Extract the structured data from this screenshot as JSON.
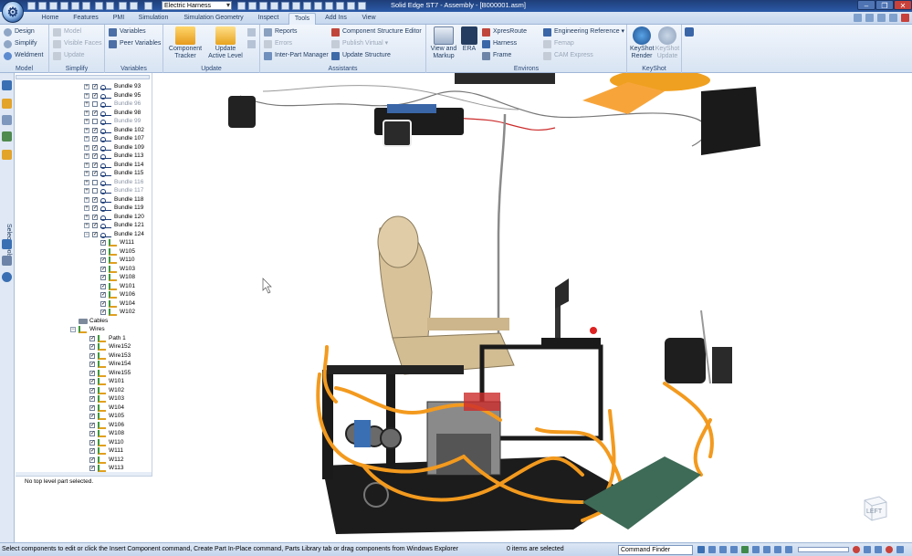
{
  "titlebar": {
    "environment": "Electric Harness",
    "window_title": "Solid Edge ST7 - Assembly - [B000001.asm]",
    "minimize": "–",
    "restore": "❐",
    "close": "✕"
  },
  "tabs": [
    {
      "label": "Home"
    },
    {
      "label": "Features"
    },
    {
      "label": "PMI"
    },
    {
      "label": "Simulation"
    },
    {
      "label": "Simulation Geometry"
    },
    {
      "label": "Inspect"
    },
    {
      "label": "Tools",
      "active": true
    },
    {
      "label": "Add Ins"
    },
    {
      "label": "View"
    }
  ],
  "ribbon": {
    "model": {
      "label": "Model",
      "items": [
        "Design",
        "Simplify",
        "Weldment"
      ]
    },
    "simplify": {
      "label": "Simplify",
      "items": [
        "Model",
        "Visible Faces",
        "Update"
      ]
    },
    "variables": {
      "label": "Variables",
      "items": [
        "Variables",
        "Peer Variables"
      ]
    },
    "update": {
      "label": "Update",
      "component_tracker": "Component Tracker",
      "update_active_level": "Update Active Level"
    },
    "assistants": {
      "label": "Assistants",
      "reports": "Reports",
      "errors": "Errors",
      "inter_part_manager": "Inter-Part Manager",
      "component_structure_editor": "Component Structure Editor",
      "publish_virtual": "Publish Virtual",
      "update_structure": "Update Structure"
    },
    "environs": {
      "label": "Environs",
      "view_markup": "View and Markup",
      "era": "ERA",
      "xpresroute": "XpresRoute",
      "harness": "Harness",
      "frame": "Frame",
      "engineering_reference": "Engineering Reference",
      "femap": "Femap",
      "cam_express": "CAM Express"
    },
    "keyshot": {
      "label": "KeyShot",
      "render": "KeyShot Render",
      "update": "KeyShot Update"
    }
  },
  "left_strip": {
    "select_tools": "Select Tools"
  },
  "pathfinder": {
    "bundles": [
      {
        "label": "Bundle 93",
        "checked": true
      },
      {
        "label": "Bundle 95",
        "checked": true
      },
      {
        "label": "Bundle 96",
        "checked": false
      },
      {
        "label": "Bundle 98",
        "checked": true
      },
      {
        "label": "Bundle 99",
        "checked": false
      },
      {
        "label": "Bundle 102",
        "checked": true
      },
      {
        "label": "Bundle 107",
        "checked": true
      },
      {
        "label": "Bundle 109",
        "checked": true
      },
      {
        "label": "Bundle 113",
        "checked": true
      },
      {
        "label": "Bundle 114",
        "checked": true
      },
      {
        "label": "Bundle 115",
        "checked": true
      },
      {
        "label": "Bundle 116",
        "checked": false
      },
      {
        "label": "Bundle 117",
        "checked": false
      },
      {
        "label": "Bundle 118",
        "checked": true
      },
      {
        "label": "Bundle 119",
        "checked": true
      },
      {
        "label": "Bundle 120",
        "checked": true
      },
      {
        "label": "Bundle 121",
        "checked": true
      },
      {
        "label": "Bundle 124",
        "checked": true
      }
    ],
    "bundle_124_wires": [
      "W111",
      "W105",
      "W110",
      "W103",
      "W108",
      "W101",
      "W106",
      "W104",
      "W102"
    ],
    "cables_label": "Cables",
    "wires_label": "Wires",
    "wires": [
      "Path 1",
      "Wire152",
      "Wire153",
      "Wire154",
      "Wire155",
      "W101",
      "W102",
      "W103",
      "W104",
      "W105",
      "W106",
      "W108",
      "W110",
      "W111",
      "W112",
      "W113"
    ],
    "status": "No top level part selected."
  },
  "graphics": {
    "view_cube_label": "LEFT"
  },
  "statusbar": {
    "prompt": "Select components to edit or click the Insert Component command, Create Part In-Place command, Parts Library tab or drag components from Windows Explorer",
    "selection_count": "0 items are selected",
    "command_finder": "Command Finder"
  },
  "colors": {
    "harness_orange": "#f39a1e",
    "frame_black": "#1a1a1a",
    "seat_beige": "#d8c29a",
    "accent_blue": "#2b5aa8"
  }
}
